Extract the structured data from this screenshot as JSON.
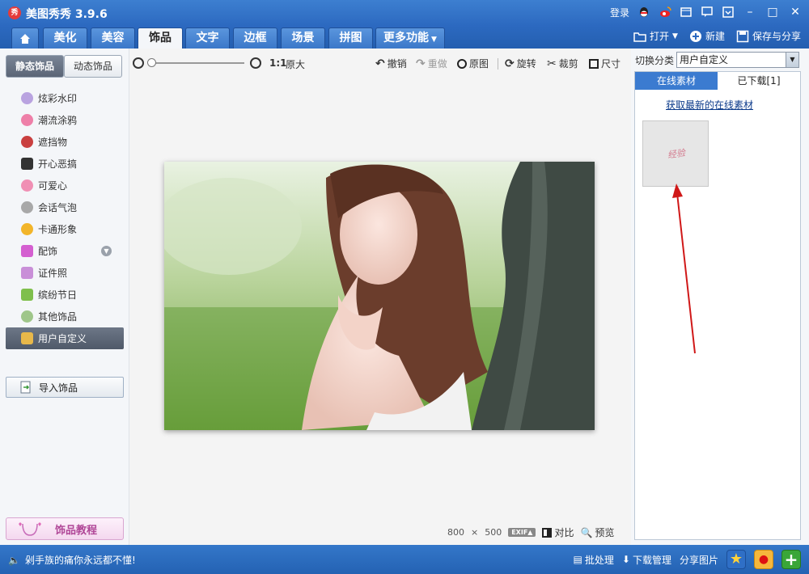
{
  "window": {
    "app_title": "美图秀秀 3.9.6",
    "logo_text": "秀",
    "login": "登录"
  },
  "main_tabs": [
    "美化",
    "美容",
    "饰品",
    "文字",
    "边框",
    "场景",
    "拼图",
    "更多功能"
  ],
  "active_tab": "饰品",
  "top_actions": {
    "open": "打开",
    "new": "新建",
    "save_share": "保存与分享"
  },
  "left_panel": {
    "subtabs": [
      "静态饰品",
      "动态饰品"
    ],
    "categories": [
      {
        "label": "炫彩水印",
        "color": "#b9a3e0"
      },
      {
        "label": "潮流涂鸦",
        "color": "#ee7fa8"
      },
      {
        "label": "遮挡物",
        "color": "#c93f3f"
      },
      {
        "label": "开心恶搞",
        "color": "#333333"
      },
      {
        "label": "可爱心",
        "color": "#f08fb4"
      },
      {
        "label": "会话气泡",
        "color": "#a8a8a8"
      },
      {
        "label": "卡通形象",
        "color": "#f2b52a"
      },
      {
        "label": "配饰",
        "color": "#d45fd0"
      },
      {
        "label": "证件照",
        "color": "#c98fd8"
      },
      {
        "label": "缤纷节日",
        "color": "#7fbf4c"
      },
      {
        "label": "其他饰品",
        "color": "#9fc68a"
      },
      {
        "label": "用户自定义",
        "color": "#e8b84a"
      }
    ],
    "selected_category": "用户自定义",
    "import_button": "导入饰品",
    "tutorial_button": "饰品教程"
  },
  "toolbar": {
    "ratio": "1:1",
    "original_size": "原大",
    "undo": "撤销",
    "redo": "重做",
    "original": "原图",
    "rotate": "旋转",
    "crop": "裁剪",
    "size": "尺寸"
  },
  "canvas_info": {
    "width": "800",
    "times": "×",
    "height": "500",
    "exif": "EXIF▲",
    "compare": "对比",
    "preview": "预览"
  },
  "right_panel": {
    "switch_label": "切换分类",
    "select_value": "用户自定义",
    "tabs": [
      "在线素材",
      "已下载[1]"
    ],
    "active_tab": "已下载[1]",
    "get_link": "获取最新的在线素材",
    "thumb_text": "经验"
  },
  "bottom": {
    "status_text": "剁手族的痛你永远都不懂!",
    "batch": "批处理",
    "download_manager": "下载管理",
    "share": "分享图片"
  },
  "colors": {
    "accent_blue": "#2c69c0",
    "arrow_red": "#d01818"
  }
}
